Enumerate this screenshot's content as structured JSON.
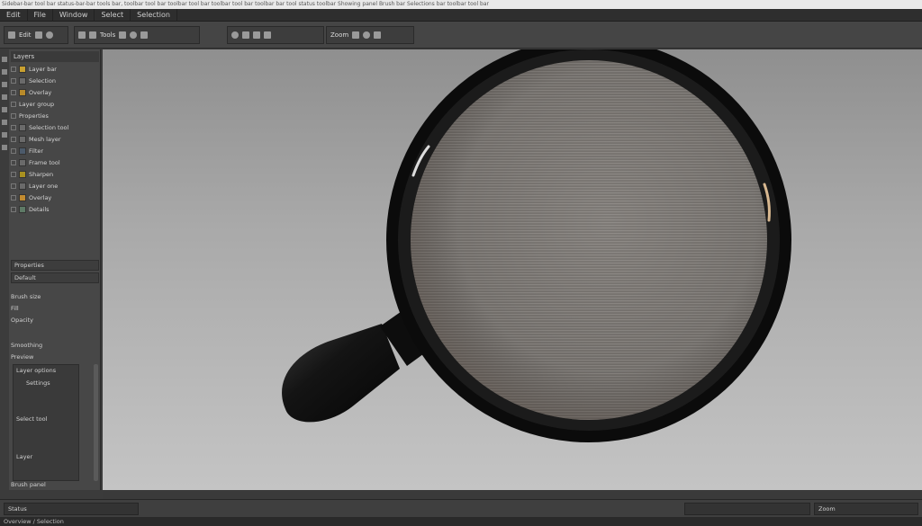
{
  "window": {
    "title_text": "Sidebar-bar tool bar status-bar-bar tools bar, toolbar tool bar toolbar tool bar toolbar tool bar toolbar bar tool status toolbar Showing panel Brush bar Selections bar toolbar tool bar"
  },
  "menu": {
    "items": [
      "Edit",
      "File",
      "Window",
      "Select",
      "Selection"
    ]
  },
  "toolbar": {
    "groups": [
      {
        "label": "Edit"
      },
      {
        "label": "Tools"
      },
      {
        "label": "Zoom"
      }
    ]
  },
  "sidebar": {
    "panel_title": "Layers",
    "layers": [
      "Layer bar",
      "Selection",
      "Overlay",
      "Layer group",
      "Properties",
      "Selection tool",
      "Mesh layer",
      "Filter",
      "Frame tool",
      "Sharpen",
      "Layer one",
      "Overlay",
      "Details"
    ],
    "subpanel_title": "Properties",
    "subpanel_value": "Default",
    "props": [
      "Brush size",
      "Fill",
      "Opacity",
      "Smoothing",
      "Preview"
    ],
    "inner": [
      "Layer options",
      "Settings",
      "Select tool",
      "Layer"
    ],
    "footer": "Brush panel"
  },
  "bottom": {
    "left_label": "Status",
    "right_label": "Zoom"
  },
  "status": {
    "text": "Overview / Selection"
  },
  "colors": {
    "lens_rim": "#0b0b0b",
    "handle": "#111111",
    "lens_mesh": "#7a7672",
    "canvas_top": "#8f8f8f",
    "canvas_bottom": "#c4c4c4"
  },
  "icons": {
    "magnifier": "magnifying-glass-image"
  }
}
